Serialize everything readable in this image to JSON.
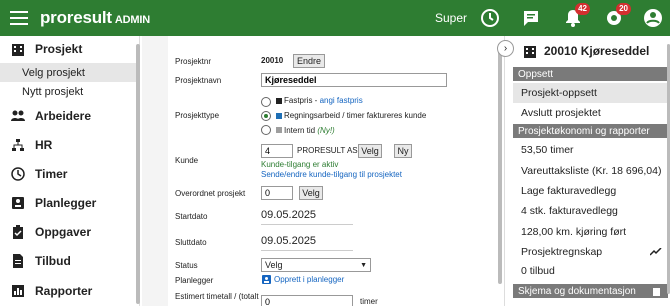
{
  "header": {
    "logo": "proresult",
    "logo_suffix": "ADMIN",
    "user": "Super",
    "badges": {
      "notifications": "42",
      "tasks": "20"
    }
  },
  "sidebar": {
    "project": "Prosjekt",
    "sub": [
      "Velg prosjekt",
      "Nytt prosjekt"
    ],
    "items": [
      "Arbeidere",
      "HR",
      "Timer",
      "Planlegger",
      "Oppgaver",
      "Tilbud",
      "Rapporter"
    ]
  },
  "form": {
    "labels": {
      "number": "Prosjektnr",
      "name": "Prosjektnavn",
      "type": "Prosjekttype",
      "customer": "Kunde",
      "parent": "Overordnet prosjekt",
      "start": "Startdato",
      "end": "Sluttdato",
      "status": "Status",
      "planner": "Planlegger",
      "estimate": "Estimert timetall / (totalt"
    },
    "number": "20010",
    "change_button": "Endre",
    "name": "Kjøreseddel",
    "type_fixed": "Fastpris -",
    "type_fixed_link": "angi fastpris",
    "type_hourly": "Regningsarbeid / timer faktureres kunde",
    "type_internal": "Intern tid",
    "type_internal_note": "(Ny!)",
    "customer_id": "4",
    "customer_name": "PRORESULT AS",
    "select_button": "Velg",
    "new_button": "Ny",
    "customer_access": "Kunde-tilgang er aktiv",
    "customer_access_link": "Sende/endre kunde-tilgang til prosjektet",
    "parent_id": "0",
    "start_date": "09.05.2025",
    "end_date": "09.05.2025",
    "status_value": "Velg",
    "planner_link": "Opprett i planlegger",
    "estimate_value": "0",
    "estimate_unit": "timer"
  },
  "right": {
    "title": "20010 Kjøreseddel",
    "sections": {
      "setup": "Oppsett",
      "economy": "Prosjektøkonomi og rapporter",
      "docs": "Skjema og dokumentasjon"
    },
    "setup_items": [
      "Prosjekt-oppsett",
      "Avslutt prosjektet"
    ],
    "economy_items": [
      "53,50 timer",
      "Vareuttaksliste (Kr. 18 696,04)",
      "Lage fakturavedlegg",
      "4 stk. fakturavedlegg",
      "128,00 km. kjøring ført",
      "Prosjektregnskap",
      "0 tilbud"
    ]
  },
  "colors": {
    "brand": "#2e7d32",
    "section_header": "#7a7a7a",
    "badge": "#d32f2f",
    "link": "#1565c0"
  }
}
